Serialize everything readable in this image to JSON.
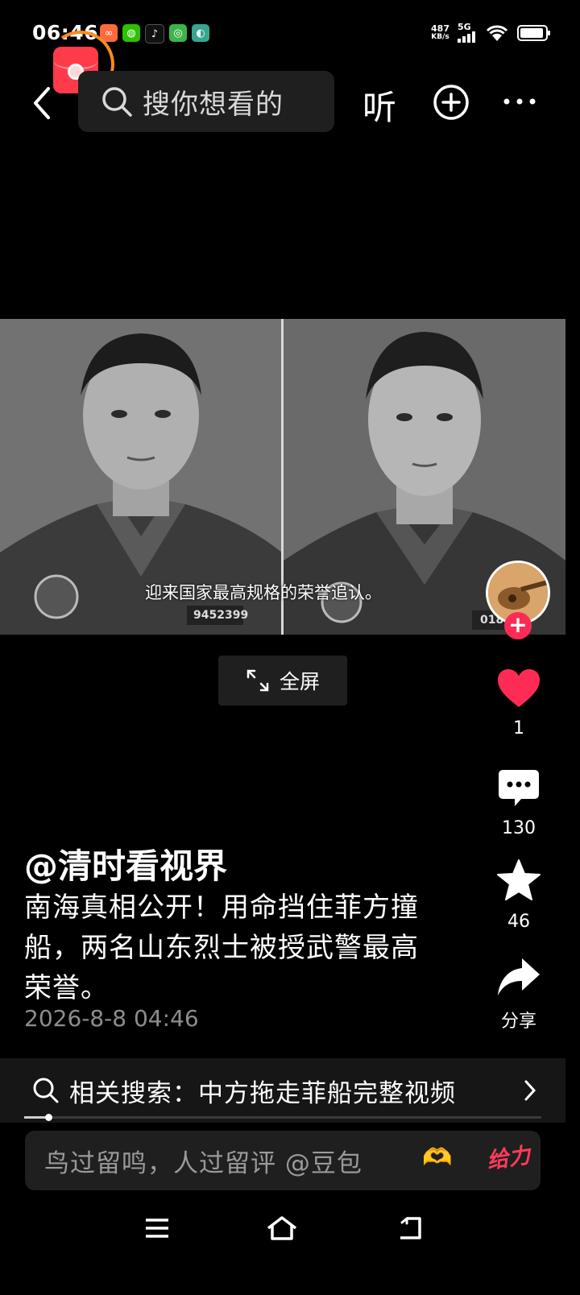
{
  "status_bar": {
    "time": "06:46",
    "net_speed_value": "487",
    "net_speed_unit": "KB/s",
    "network_type": "5G",
    "app_icons": [
      "xiaohongshu-icon",
      "wechat-icon",
      "douyin-icon",
      "app-green-icon",
      "app-shield-icon"
    ]
  },
  "header": {
    "search_placeholder": "搜你想看的",
    "listen_label": "听"
  },
  "video": {
    "subtitle": "迎来国家最高规格的荣誉追认。",
    "badge_left": "9452399",
    "badge_right": "0189",
    "fullscreen_label": "全屏"
  },
  "actions": {
    "likes": "1",
    "comments": "130",
    "favorites": "46",
    "share_label": "分享"
  },
  "post": {
    "author": "@清时看视界",
    "description": "南海真相公开！用命挡住菲方撞船，两名山东烈士被授武警最高荣誉。",
    "date": "2026-8-8 04:46"
  },
  "related_search": {
    "text": "相关搜索：中方拖走菲船完整视频"
  },
  "comment": {
    "placeholder": "鸟过留鸣，人过留评 @豆包",
    "give_label": "给力"
  },
  "colors": {
    "like_red": "#fe2c55",
    "accent_orange": "#ff8a1f"
  }
}
